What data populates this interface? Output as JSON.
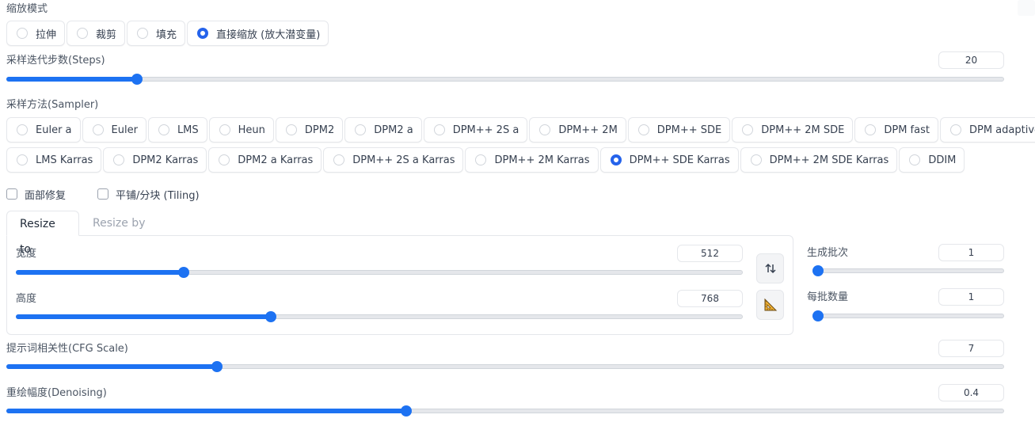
{
  "resize_mode": {
    "label": "缩放模式",
    "options": [
      "拉伸",
      "裁剪",
      "填充",
      "直接缩放 (放大潜变量)"
    ],
    "selected": "直接缩放 (放大潜变量)"
  },
  "steps": {
    "label": "采样迭代步数(Steps)",
    "value": "20",
    "min": 1,
    "max": 150,
    "fraction": 0.13
  },
  "sampler": {
    "label": "采样方法(Sampler)",
    "row1": [
      "Euler a",
      "Euler",
      "LMS",
      "Heun",
      "DPM2",
      "DPM2 a",
      "DPM++ 2S a",
      "DPM++ 2M",
      "DPM++ SDE",
      "DPM++ 2M SDE",
      "DPM fast",
      "DPM adaptive"
    ],
    "row2": [
      "LMS Karras",
      "DPM2 Karras",
      "DPM2 a Karras",
      "DPM++ 2S a Karras",
      "DPM++ 2M Karras",
      "DPM++ SDE Karras",
      "DPM++ 2M SDE Karras",
      "DDIM"
    ],
    "selected": "DPM++ SDE Karras"
  },
  "checkboxes": {
    "face_restore": "面部修复",
    "tiling": "平铺/分块 (Tiling)"
  },
  "tabs": {
    "resize_to": "Resize to",
    "resize_by": "Resize by",
    "active": "Resize to"
  },
  "width": {
    "label": "宽度",
    "value": "512",
    "fraction": 0.23
  },
  "height": {
    "label": "高度",
    "value": "768",
    "fraction": 0.35
  },
  "batch_count": {
    "label": "生成批次",
    "value": "1",
    "fraction": 0.0
  },
  "batch_size": {
    "label": "每批数量",
    "value": "1",
    "fraction": 0.0
  },
  "cfg": {
    "label": "提示词相关性(CFG Scale)",
    "value": "7",
    "fraction": 0.21
  },
  "denoising": {
    "label": "重绘幅度(Denoising)",
    "value": "0.4",
    "fraction": 0.4
  },
  "icons": {
    "swap": "swap-vertical-icon",
    "ratio": "triangle-ruler-icon"
  },
  "colors": {
    "accent": "#1d72f2",
    "radio_selected": "#2563eb",
    "track": "#e5e7eb"
  }
}
